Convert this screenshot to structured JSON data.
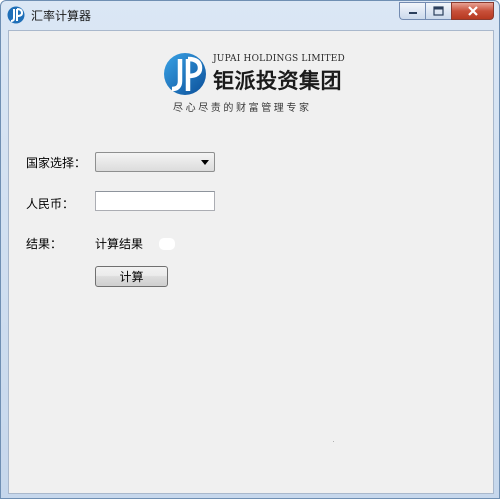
{
  "window": {
    "title": "汇率计算器"
  },
  "logo": {
    "english_name": "JUPAI HOLDINGS LIMITED",
    "chinese_name": "钜派投资集团",
    "slogan": "尽心尽责的财富管理专家",
    "brand_color": "#1f7fc8"
  },
  "form": {
    "country_label": "国家选择：",
    "country_selected": "",
    "rmb_label": "人民币：",
    "rmb_value": "",
    "result_label": "结果：",
    "result_value": "计算结果",
    "calculate_button": "计算"
  },
  "icons": {
    "app": "jupai-logo-icon",
    "minimize": "minimize-icon",
    "maximize": "maximize-icon",
    "close": "close-icon",
    "dropdown": "chevron-down-icon"
  }
}
